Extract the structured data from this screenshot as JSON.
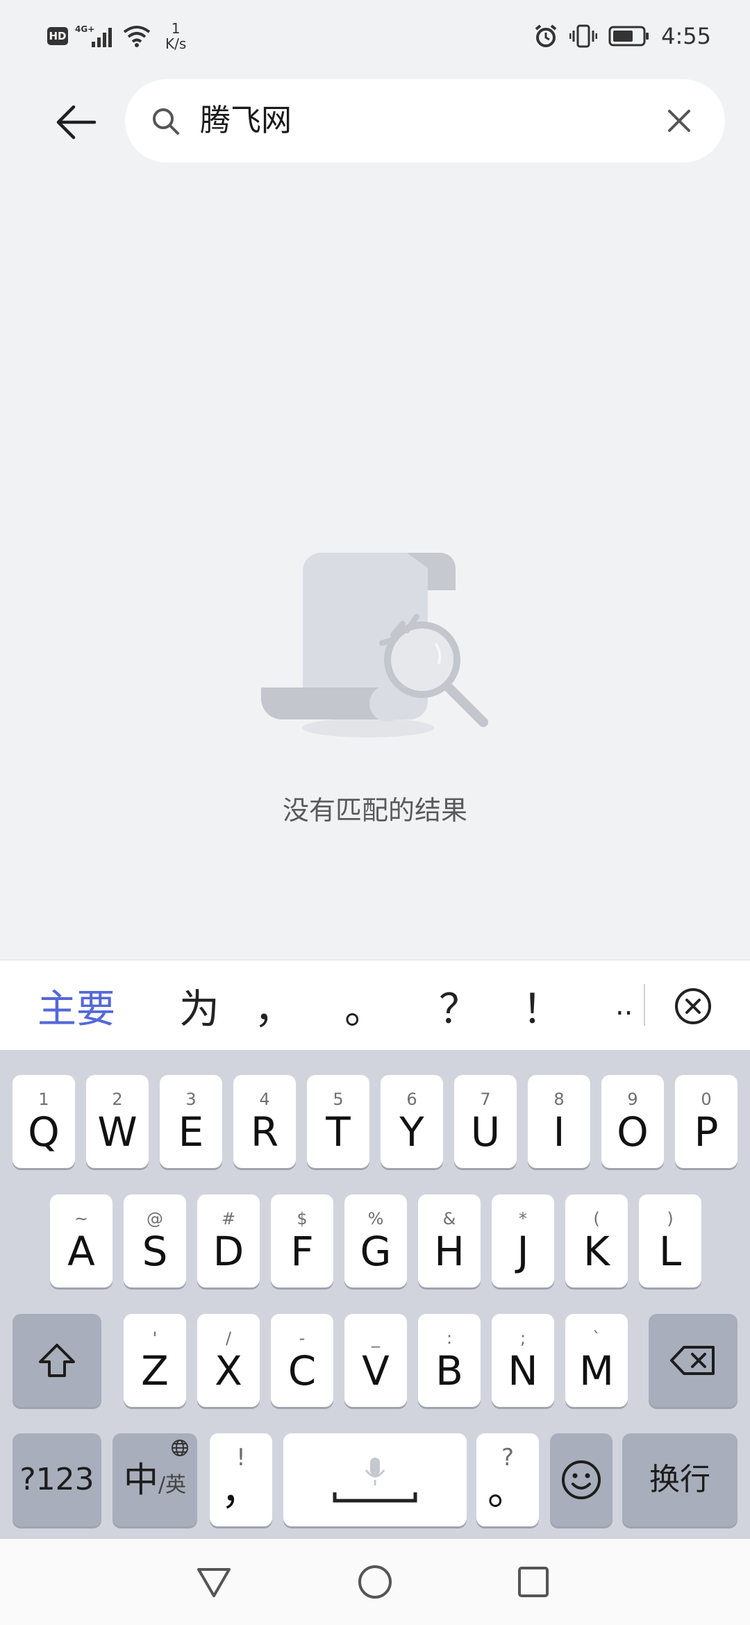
{
  "status_bar": {
    "hd": "HD",
    "net_speed_value": "1",
    "net_speed_unit": "K/s",
    "time": "4:55"
  },
  "search": {
    "query": "腾飞网"
  },
  "empty_state": {
    "message": "没有匹配的结果"
  },
  "candidates": {
    "main": "主要",
    "items": [
      "为",
      "，",
      "。",
      "？",
      "！",
      ".."
    ]
  },
  "keyboard": {
    "row1": [
      {
        "main": "Q",
        "sub": "1"
      },
      {
        "main": "W",
        "sub": "2"
      },
      {
        "main": "E",
        "sub": "3"
      },
      {
        "main": "R",
        "sub": "4"
      },
      {
        "main": "T",
        "sub": "5"
      },
      {
        "main": "Y",
        "sub": "6"
      },
      {
        "main": "U",
        "sub": "7"
      },
      {
        "main": "I",
        "sub": "8"
      },
      {
        "main": "O",
        "sub": "9"
      },
      {
        "main": "P",
        "sub": "0"
      }
    ],
    "row2": [
      {
        "main": "A",
        "sub": "~"
      },
      {
        "main": "S",
        "sub": "@"
      },
      {
        "main": "D",
        "sub": "#"
      },
      {
        "main": "F",
        "sub": "$"
      },
      {
        "main": "G",
        "sub": "%"
      },
      {
        "main": "H",
        "sub": "&"
      },
      {
        "main": "J",
        "sub": "*"
      },
      {
        "main": "K",
        "sub": "("
      },
      {
        "main": "L",
        "sub": ")"
      }
    ],
    "row3": [
      {
        "main": "Z",
        "sub": "'"
      },
      {
        "main": "X",
        "sub": "/"
      },
      {
        "main": "C",
        "sub": "-"
      },
      {
        "main": "V",
        "sub": "_"
      },
      {
        "main": "B",
        "sub": ":"
      },
      {
        "main": "N",
        "sub": ";"
      },
      {
        "main": "M",
        "sub": "`"
      }
    ],
    "symbols_key": "?123",
    "lang_key_main": "中",
    "lang_key_sub": "/英",
    "comma_key_main": "，",
    "comma_key_sub": "!",
    "period_key_main": "。",
    "period_key_sub": "?",
    "enter_key": "换行"
  },
  "colors": {
    "accent": "#5468d8",
    "keyboard_bg": "#d2d4dd",
    "page_bg": "#f1f2f4"
  }
}
